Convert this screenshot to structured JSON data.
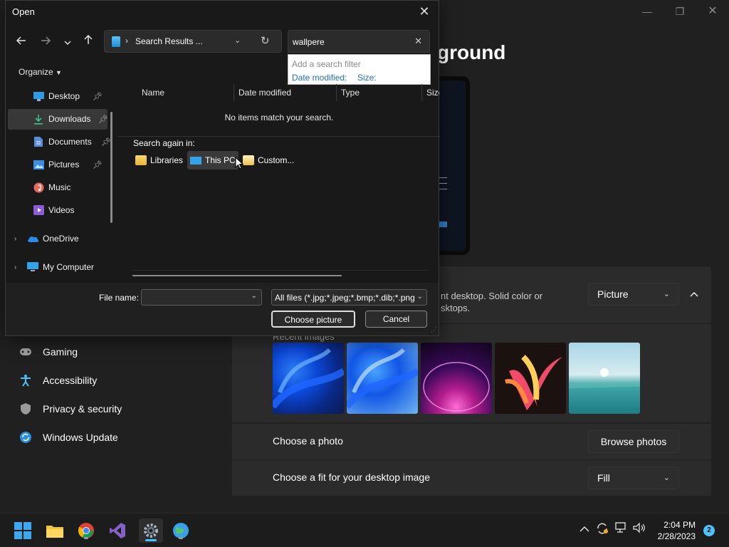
{
  "settings": {
    "heading": "ground",
    "background_desc_line1": "nt desktop. Solid color or",
    "background_desc_line2": "sktops.",
    "background_type": "Picture",
    "recent_images_label": "Recent images",
    "choose_photo_label": "Choose a photo",
    "browse_photos_label": "Browse photos",
    "fit_label": "Choose a fit for your desktop image",
    "fit_value": "Fill",
    "nav": [
      {
        "label": "Gaming",
        "icon": "gamepad-icon"
      },
      {
        "label": "Accessibility",
        "icon": "accessibility-icon"
      },
      {
        "label": "Privacy & security",
        "icon": "shield-icon"
      },
      {
        "label": "Windows Update",
        "icon": "update-icon"
      }
    ]
  },
  "dialog": {
    "title": "Open",
    "address_path": "Search Results ...",
    "search_value": "wallpere",
    "search_filter_hint": "Add a search filter",
    "filter_options": [
      "Date modified:",
      "Size:"
    ],
    "organize_label": "Organize",
    "tree": [
      {
        "label": "Desktop",
        "icon": "desktop-icon",
        "pinned": true
      },
      {
        "label": "Downloads",
        "icon": "download-icon",
        "pinned": true
      },
      {
        "label": "Documents",
        "icon": "documents-icon",
        "pinned": true
      },
      {
        "label": "Pictures",
        "icon": "pictures-icon",
        "pinned": true
      },
      {
        "label": "Music",
        "icon": "music-icon",
        "pinned": false
      },
      {
        "label": "Videos",
        "icon": "videos-icon",
        "pinned": false
      },
      {
        "label": "OneDrive",
        "icon": "cloud-icon",
        "pinned": false
      },
      {
        "label": "My Computer",
        "icon": "computer-icon",
        "pinned": false
      }
    ],
    "selected_tree_item": "Downloads",
    "columns": [
      "Name",
      "Date modified",
      "Type",
      "Size"
    ],
    "empty_message": "No items match your search.",
    "search_again_label": "Search again in:",
    "search_again_items": [
      "Libraries",
      "This PC",
      "Custom..."
    ],
    "file_name_label": "File name:",
    "file_name_value": "",
    "file_type": "All files (*.jpg;*.jpeg;*.bmp;*.dib;*.png",
    "primary_button": "Choose picture",
    "cancel_button": "Cancel"
  },
  "taskbar": {
    "time": "2:04 PM",
    "date": "2/28/2023",
    "notification_count": "2",
    "apps": [
      "start-icon",
      "file-explorer-icon",
      "chrome-icon",
      "visual-studio-icon",
      "settings-icon",
      "maps-icon"
    ]
  },
  "colors": {
    "accent": "#4cc2ff",
    "background": "#202020",
    "dialog_bg": "#191919",
    "link": "#1f6fc4"
  }
}
